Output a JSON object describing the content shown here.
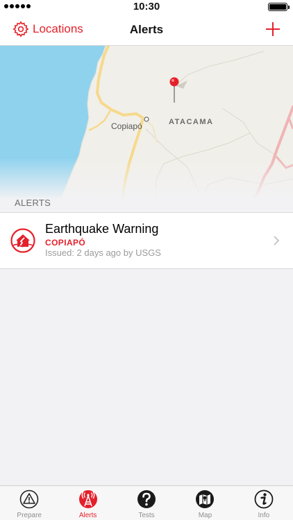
{
  "status_bar": {
    "time": "10:30",
    "signal_bars": 5
  },
  "nav": {
    "left_label": "Locations",
    "title": "Alerts",
    "left_icon": "gear-icon",
    "right_icon": "plus-icon"
  },
  "map": {
    "city_label": "Copiapó",
    "region_label": "ATACAMA",
    "pin_icon": "map-pin-icon"
  },
  "section_header": "ALERTS",
  "alerts": [
    {
      "title": "Earthquake Warning",
      "location": "COPIAPÓ",
      "meta": "Issued: 2 days ago by USGS",
      "icon": "earthquake-house-icon"
    }
  ],
  "tabs": [
    {
      "label": "Prepare",
      "icon": "warning-triangle-icon",
      "active": false
    },
    {
      "label": "Alerts",
      "icon": "broadcast-tower-icon",
      "active": true
    },
    {
      "label": "Tests",
      "icon": "question-circle-icon",
      "active": false
    },
    {
      "label": "Map",
      "icon": "map-book-icon",
      "active": false
    },
    {
      "label": "Info",
      "icon": "info-circle-icon",
      "active": false
    }
  ],
  "colors": {
    "accent": "#e4212b",
    "water": "#8fd2ee",
    "road": "#f6d98c",
    "border_road": "#f0b4b4",
    "land": "#f1efe9"
  }
}
